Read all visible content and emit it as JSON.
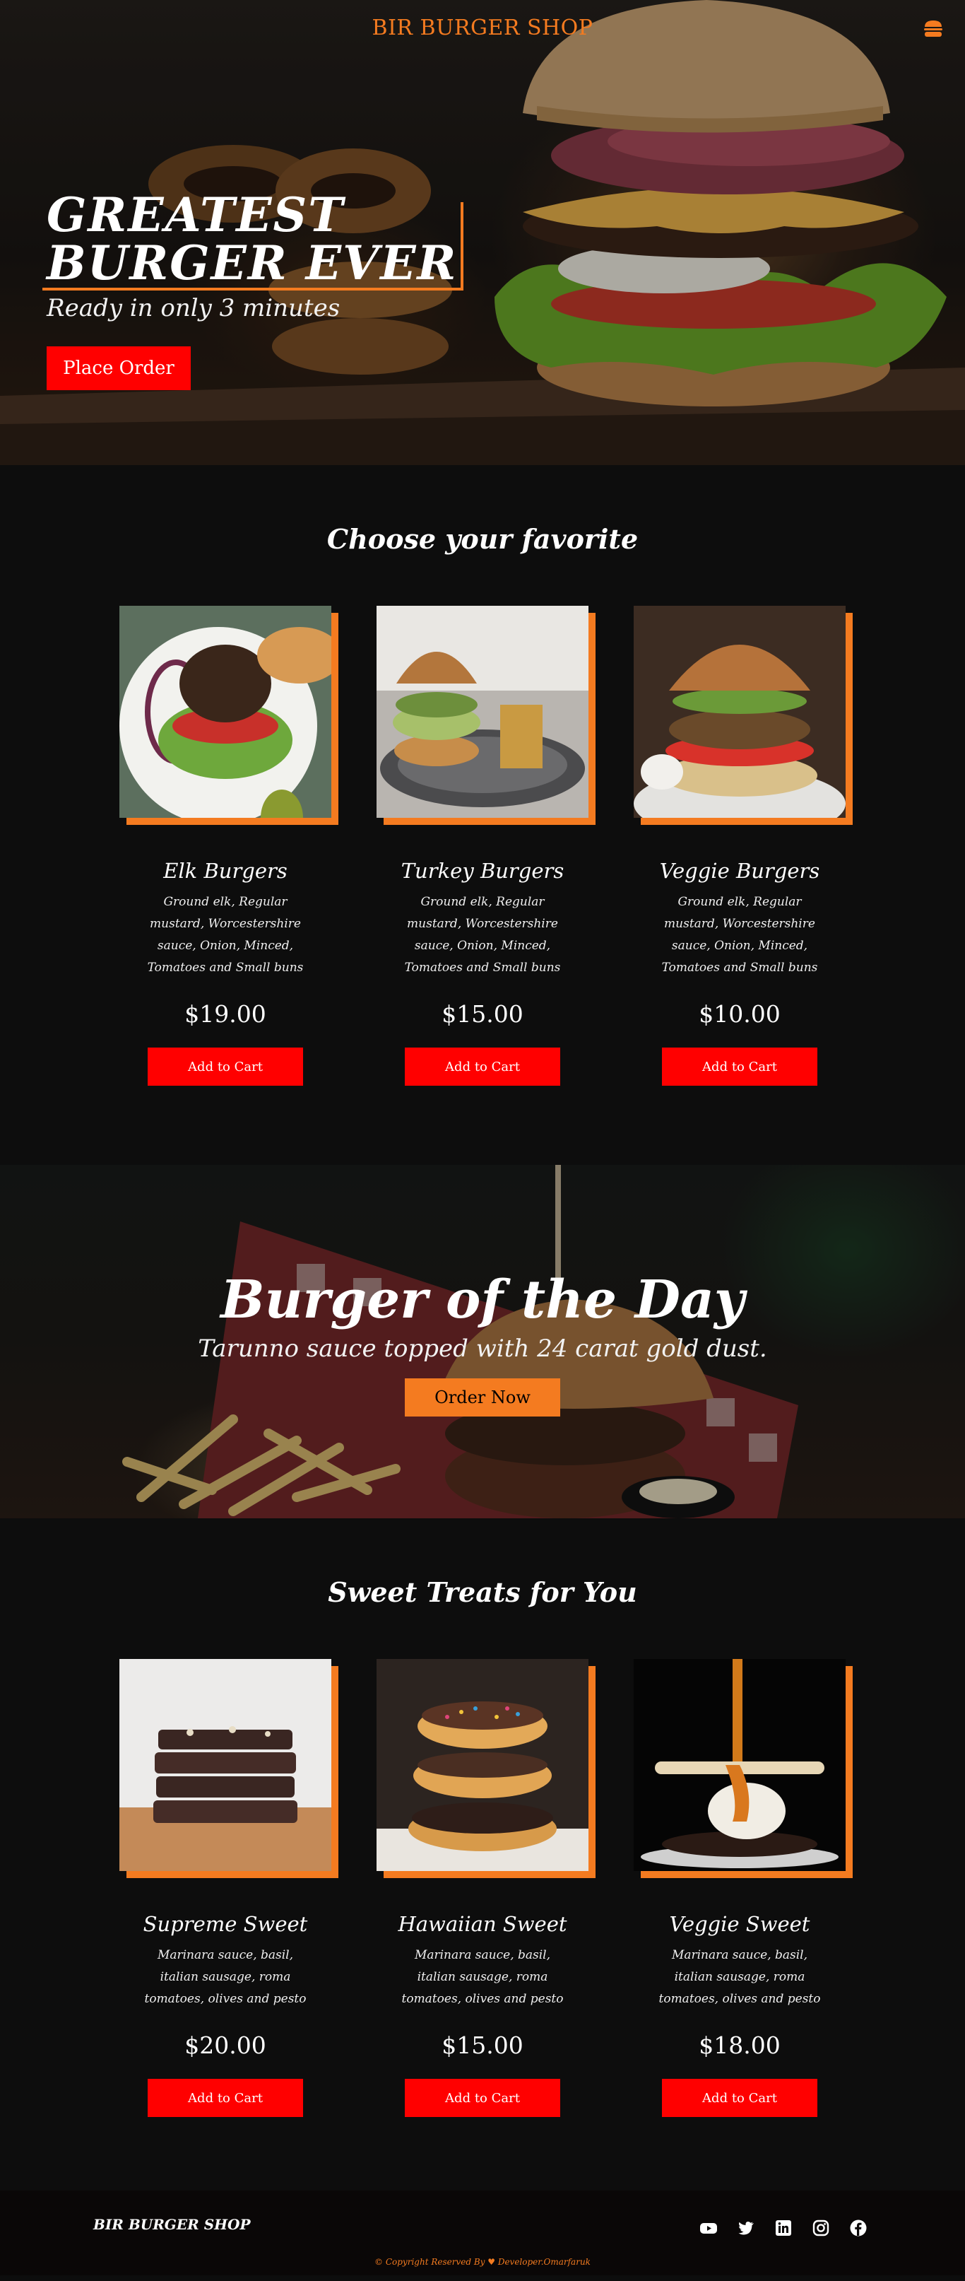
{
  "header": {
    "brand": "BIR BURGER SHOP",
    "menu_icon": "hamburger-menu-icon"
  },
  "hero": {
    "title_line1": "GREATEST",
    "title_line2": "BURGER EVER",
    "subtitle": "Ready in only 3 minutes",
    "cta_label": "Place Order"
  },
  "favorites": {
    "title": "Choose your favorite",
    "items": [
      {
        "name": "Elk Burgers",
        "description": "Ground elk, Regular mustard, Worcestershire sauce, Onion, Minced, Tomatoes and Small buns",
        "price": "$19.00",
        "cta": "Add to Cart",
        "image_icon": "elk-burger-plate-image"
      },
      {
        "name": "Turkey Burgers",
        "description": "Ground elk, Regular mustard, Worcestershire sauce, Onion, Minced, Tomatoes and Small buns",
        "price": "$15.00",
        "cta": "Add to Cart",
        "image_icon": "turkey-burger-fries-image"
      },
      {
        "name": "Veggie Burgers",
        "description": "Ground elk, Regular mustard, Worcestershire sauce, Onion, Minced, Tomatoes and Small buns",
        "price": "$10.00",
        "cta": "Add to Cart",
        "image_icon": "veggie-burger-image"
      }
    ]
  },
  "burger_of_the_day": {
    "title": "Burger of the Day",
    "subtitle": "Tarunno sauce topped with 24 carat gold dust.",
    "cta_label": "Order Now"
  },
  "sweets": {
    "title": "Sweet Treats for You",
    "items": [
      {
        "name": "Supreme Sweet",
        "description": "Marinara sauce, basil, italian sausage, roma tomatoes, olives and pesto",
        "price": "$20.00",
        "cta": "Add to Cart",
        "image_icon": "brownie-stack-image"
      },
      {
        "name": "Hawaiian Sweet",
        "description": "Marinara sauce, basil, italian sausage, roma tomatoes, olives and pesto",
        "price": "$15.00",
        "cta": "Add to Cart",
        "image_icon": "donut-stack-image"
      },
      {
        "name": "Veggie Sweet",
        "description": "Marinara sauce, basil, italian sausage, roma tomatoes, olives and pesto",
        "price": "$18.00",
        "cta": "Add to Cart",
        "image_icon": "ice-cream-dessert-image"
      }
    ]
  },
  "footer": {
    "brand": "BIR BURGER SHOP",
    "socials": [
      "youtube-icon",
      "twitter-icon",
      "linkedin-icon",
      "instagram-icon",
      "facebook-icon"
    ],
    "copyright": "© Copyright Reserved By ♥ Developer.Omarfaruk"
  },
  "colors": {
    "accent_orange": "#f47b20",
    "button_red": "#ff0000",
    "background": "#0d0d0d"
  }
}
